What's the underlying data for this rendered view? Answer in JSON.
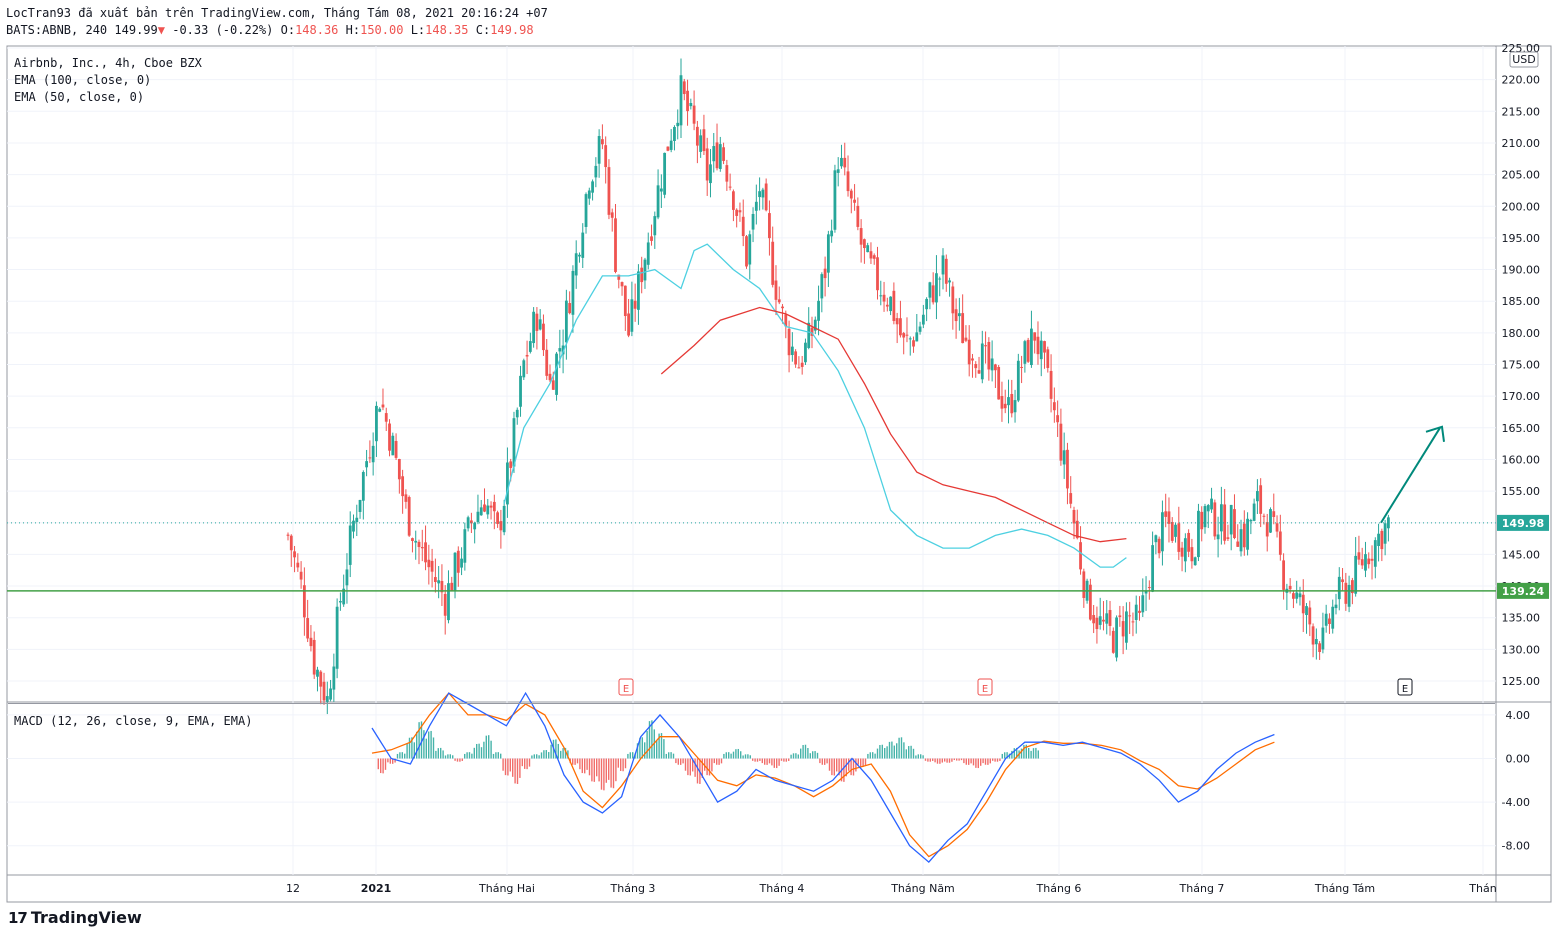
{
  "header": {
    "line1": "LocTran93 đã xuất bản trên TradingView.com, Tháng Tám 08, 2021 20:16:24 +07",
    "symbol": "BATS:ABNB, 240",
    "last": "149.99",
    "change_arrow": "▼",
    "change": "-0.33 (-0.22%)",
    "o_label": "O:",
    "o": "148.36",
    "h_label": "H:",
    "h": "150.00",
    "l_label": "L:",
    "l": "148.35",
    "c_label": "C:",
    "c": "149.98"
  },
  "legend": {
    "title": "Airbnb, Inc., 4h, Cboe BZX",
    "ema100": "EMA (100, close, 0)",
    "ema50": "EMA (50, close, 0)",
    "macd": "MACD (12, 26, close, 9, EMA, EMA)"
  },
  "brand": {
    "name": "TradingView"
  },
  "colors": {
    "up": "#26a69a",
    "down": "#ef5350",
    "ema50": "#4dd0e1",
    "ema100": "#e53935",
    "support": "#43a047",
    "macd": "#2962ff",
    "signal": "#ff6d00",
    "arrow": "#00897b"
  },
  "chart_data": [
    {
      "type": "candlestick",
      "title": "Airbnb, Inc., 4h, Cboe BZX",
      "currency": "USD",
      "ylim": [
        122,
        225
      ],
      "y_ticks": [
        "125.00",
        "130.00",
        "135.00",
        "140.00",
        "145.00",
        "150.00",
        "155.00",
        "160.00",
        "165.00",
        "170.00",
        "175.00",
        "180.00",
        "185.00",
        "190.00",
        "195.00",
        "200.00",
        "205.00",
        "210.00",
        "215.00",
        "220.00",
        "225.00"
      ],
      "x_labels": [
        "12",
        "2021",
        "Tháng Hai",
        "Tháng 3",
        "Tháng 4",
        "Tháng Năm",
        "Tháng 6",
        "Tháng 7",
        "Tháng Tám",
        "Thán"
      ],
      "close_path": [
        [
          0,
          148
        ],
        [
          2,
          140
        ],
        [
          4,
          128
        ],
        [
          6,
          122
        ],
        [
          8,
          138
        ],
        [
          10,
          150
        ],
        [
          12,
          160
        ],
        [
          14,
          170
        ],
        [
          16,
          162
        ],
        [
          18,
          152
        ],
        [
          20,
          146
        ],
        [
          22,
          142
        ],
        [
          24,
          138
        ],
        [
          26,
          144
        ],
        [
          28,
          150
        ],
        [
          30,
          154
        ],
        [
          32,
          148
        ],
        [
          34,
          160
        ],
        [
          36,
          175
        ],
        [
          38,
          183
        ],
        [
          40,
          172
        ],
        [
          42,
          180
        ],
        [
          44,
          192
        ],
        [
          46,
          205
        ],
        [
          48,
          210
        ],
        [
          50,
          192
        ],
        [
          52,
          180
        ],
        [
          54,
          190
        ],
        [
          56,
          200
        ],
        [
          58,
          210
        ],
        [
          60,
          218
        ],
        [
          62,
          212
        ],
        [
          64,
          205
        ],
        [
          66,
          210
        ],
        [
          68,
          202
        ],
        [
          70,
          192
        ],
        [
          72,
          203
        ],
        [
          74,
          190
        ],
        [
          76,
          180
        ],
        [
          78,
          175
        ],
        [
          80,
          180
        ],
        [
          82,
          190
        ],
        [
          84,
          208
        ],
        [
          86,
          200
        ],
        [
          88,
          192
        ],
        [
          90,
          188
        ],
        [
          92,
          185
        ],
        [
          94,
          178
        ],
        [
          96,
          180
        ],
        [
          98,
          186
        ],
        [
          100,
          190
        ],
        [
          102,
          182
        ],
        [
          104,
          178
        ],
        [
          106,
          176
        ],
        [
          108,
          172
        ],
        [
          110,
          168
        ],
        [
          112,
          175
        ],
        [
          114,
          180
        ],
        [
          116,
          172
        ],
        [
          118,
          162
        ],
        [
          120,
          150
        ],
        [
          122,
          138
        ],
        [
          124,
          134
        ],
        [
          126,
          132
        ],
        [
          128,
          135
        ],
        [
          130,
          134
        ],
        [
          132,
          145
        ],
        [
          134,
          150
        ],
        [
          136,
          148
        ],
        [
          138,
          146
        ],
        [
          140,
          152
        ],
        [
          142,
          150
        ],
        [
          144,
          150
        ],
        [
          146,
          148
        ],
        [
          148,
          153
        ],
        [
          150,
          150
        ],
        [
          152,
          142
        ],
        [
          154,
          138
        ],
        [
          156,
          134
        ],
        [
          158,
          131
        ],
        [
          160,
          138
        ],
        [
          162,
          140
        ],
        [
          164,
          144
        ],
        [
          166,
          147
        ],
        [
          168,
          150
        ]
      ],
      "ema50_path": [
        [
          33,
          153
        ],
        [
          36,
          165
        ],
        [
          40,
          172
        ],
        [
          44,
          182
        ],
        [
          48,
          189
        ],
        [
          52,
          189
        ],
        [
          56,
          190
        ],
        [
          60,
          187
        ],
        [
          62,
          193
        ],
        [
          64,
          194
        ],
        [
          68,
          190
        ],
        [
          72,
          187
        ],
        [
          76,
          181
        ],
        [
          80,
          180
        ],
        [
          84,
          174
        ],
        [
          88,
          165
        ],
        [
          92,
          152
        ],
        [
          96,
          148
        ],
        [
          100,
          146
        ],
        [
          104,
          146
        ],
        [
          108,
          148
        ],
        [
          112,
          149
        ],
        [
          116,
          148
        ],
        [
          120,
          146
        ],
        [
          124,
          143
        ],
        [
          126,
          143
        ],
        [
          128,
          144.5
        ]
      ],
      "ema100_path": [
        [
          57,
          173.5
        ],
        [
          62,
          178
        ],
        [
          66,
          182
        ],
        [
          72,
          184
        ],
        [
          76,
          183
        ],
        [
          80,
          181
        ],
        [
          84,
          179
        ],
        [
          88,
          172
        ],
        [
          92,
          164
        ],
        [
          96,
          158
        ],
        [
          100,
          156
        ],
        [
          104,
          155
        ],
        [
          108,
          154
        ],
        [
          112,
          152
        ],
        [
          116,
          150
        ],
        [
          120,
          148
        ],
        [
          124,
          147
        ],
        [
          128,
          147.5
        ]
      ],
      "support_level": 139.24,
      "last_price": 149.98,
      "projection_arrow": {
        "from": [
          169,
          150
        ],
        "to": [
          176,
          165
        ]
      },
      "earnings_markers": [
        "E",
        "E",
        "E"
      ]
    },
    {
      "type": "histogram+line",
      "title": "MACD (12, 26, close, 9, EMA, EMA)",
      "ylim": [
        -10.5,
        5
      ],
      "y_ticks": [
        "4.00",
        "0.00",
        "-4.00",
        "-8.00"
      ],
      "macd_path": [
        [
          10,
          2.8
        ],
        [
          12,
          0
        ],
        [
          14,
          -0.5
        ],
        [
          16,
          3
        ],
        [
          18,
          6
        ],
        [
          20,
          5
        ],
        [
          22,
          4
        ],
        [
          24,
          3
        ],
        [
          26,
          6
        ],
        [
          28,
          3
        ],
        [
          30,
          -1.5
        ],
        [
          32,
          -4
        ],
        [
          34,
          -5
        ],
        [
          36,
          -3.5
        ],
        [
          38,
          2
        ],
        [
          40,
          4
        ],
        [
          42,
          2
        ],
        [
          44,
          -1
        ],
        [
          46,
          -4
        ],
        [
          48,
          -3
        ],
        [
          50,
          -1
        ],
        [
          52,
          -2
        ],
        [
          54,
          -2.5
        ],
        [
          56,
          -3
        ],
        [
          58,
          -2
        ],
        [
          60,
          0
        ],
        [
          62,
          -2
        ],
        [
          64,
          -5
        ],
        [
          66,
          -8
        ],
        [
          68,
          -9.5
        ],
        [
          70,
          -7.5
        ],
        [
          72,
          -6
        ],
        [
          74,
          -3
        ],
        [
          76,
          0
        ],
        [
          78,
          1.5
        ],
        [
          80,
          1.5
        ],
        [
          82,
          1.2
        ],
        [
          84,
          1.5
        ],
        [
          86,
          1.0
        ],
        [
          88,
          0.5
        ],
        [
          90,
          -0.5
        ],
        [
          92,
          -2
        ],
        [
          94,
          -4
        ],
        [
          96,
          -3
        ],
        [
          98,
          -1
        ],
        [
          100,
          0.5
        ],
        [
          102,
          1.5
        ],
        [
          104,
          2.2
        ]
      ],
      "signal_path": [
        [
          10,
          0.5
        ],
        [
          12,
          0.8
        ],
        [
          14,
          1.5
        ],
        [
          16,
          4
        ],
        [
          18,
          6
        ],
        [
          20,
          4
        ],
        [
          22,
          4
        ],
        [
          24,
          3.5
        ],
        [
          26,
          5
        ],
        [
          28,
          4
        ],
        [
          30,
          1
        ],
        [
          32,
          -3
        ],
        [
          34,
          -4.5
        ],
        [
          36,
          -2.5
        ],
        [
          38,
          0
        ],
        [
          40,
          2
        ],
        [
          42,
          2
        ],
        [
          44,
          0
        ],
        [
          46,
          -2
        ],
        [
          48,
          -2.5
        ],
        [
          50,
          -1.5
        ],
        [
          52,
          -1.8
        ],
        [
          54,
          -2.5
        ],
        [
          56,
          -3.5
        ],
        [
          58,
          -2.5
        ],
        [
          60,
          -1
        ],
        [
          62,
          -0.5
        ],
        [
          64,
          -3
        ],
        [
          66,
          -7
        ],
        [
          68,
          -9
        ],
        [
          70,
          -8
        ],
        [
          72,
          -6.5
        ],
        [
          74,
          -4
        ],
        [
          76,
          -1
        ],
        [
          78,
          1
        ],
        [
          80,
          1.6
        ],
        [
          82,
          1.4
        ],
        [
          84,
          1.4
        ],
        [
          86,
          1.2
        ],
        [
          88,
          0.8
        ],
        [
          90,
          -0.2
        ],
        [
          92,
          -1
        ],
        [
          94,
          -2.5
        ],
        [
          96,
          -2.8
        ],
        [
          98,
          -1.8
        ],
        [
          100,
          -0.5
        ],
        [
          102,
          0.8
        ],
        [
          104,
          1.5
        ]
      ],
      "histogram": [
        [
          11,
          -1.4
        ],
        [
          12,
          -0.5
        ],
        [
          13,
          0.6
        ],
        [
          14,
          2.0
        ],
        [
          15,
          3.5
        ],
        [
          16,
          2.6
        ],
        [
          17,
          1.0
        ],
        [
          18,
          0.4
        ],
        [
          19,
          -0.3
        ],
        [
          20,
          0.6
        ],
        [
          21,
          1.4
        ],
        [
          22,
          2.2
        ],
        [
          23,
          0.6
        ],
        [
          24,
          -1.6
        ],
        [
          25,
          -2.4
        ],
        [
          26,
          -1.0
        ],
        [
          27,
          0.4
        ],
        [
          28,
          0.8
        ],
        [
          29,
          1.8
        ],
        [
          30,
          1.0
        ],
        [
          31,
          -0.6
        ],
        [
          32,
          -1.4
        ],
        [
          33,
          -2.2
        ],
        [
          34,
          -3.0
        ],
        [
          35,
          -2.8
        ],
        [
          36,
          -1.2
        ],
        [
          37,
          0.6
        ],
        [
          38,
          2.0
        ],
        [
          39,
          3.6
        ],
        [
          40,
          2.4
        ],
        [
          41,
          0.6
        ],
        [
          42,
          -0.6
        ],
        [
          43,
          -1.6
        ],
        [
          44,
          -2.4
        ],
        [
          45,
          -1.6
        ],
        [
          46,
          -0.6
        ],
        [
          47,
          0.6
        ],
        [
          48,
          0.9
        ],
        [
          49,
          0.4
        ],
        [
          50,
          -0.3
        ],
        [
          51,
          -0.6
        ],
        [
          52,
          -0.9
        ],
        [
          53,
          -0.3
        ],
        [
          54,
          0.5
        ],
        [
          55,
          1.3
        ],
        [
          56,
          0.7
        ],
        [
          57,
          -0.6
        ],
        [
          58,
          -1.6
        ],
        [
          59,
          -2.2
        ],
        [
          60,
          -1.6
        ],
        [
          61,
          -0.8
        ],
        [
          62,
          0.6
        ],
        [
          63,
          1.3
        ],
        [
          64,
          1.6
        ],
        [
          65,
          2.0
        ],
        [
          66,
          1.2
        ],
        [
          67,
          0.4
        ],
        [
          68,
          -0.3
        ],
        [
          69,
          -0.5
        ],
        [
          70,
          -0.4
        ],
        [
          71,
          -0.2
        ],
        [
          72,
          -0.6
        ],
        [
          73,
          -0.9
        ],
        [
          74,
          -0.6
        ],
        [
          75,
          -0.3
        ],
        [
          76,
          0.6
        ],
        [
          77,
          1.0
        ],
        [
          78,
          1.3
        ],
        [
          79,
          1.0
        ]
      ]
    }
  ]
}
